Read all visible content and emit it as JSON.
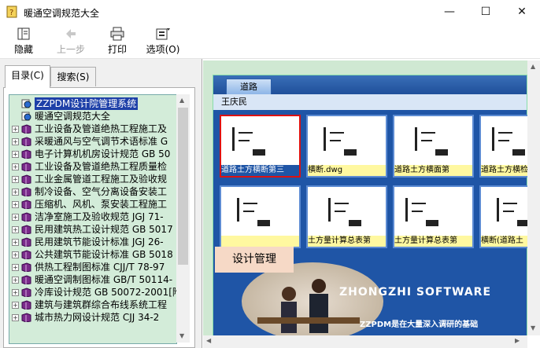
{
  "window": {
    "title": "暖通空调规范大全",
    "minimize": "—",
    "maximize": "☐",
    "close": "✕"
  },
  "toolbar": [
    {
      "label": "隐藏",
      "icon": "hide-icon",
      "enabled": true
    },
    {
      "label": "上一步",
      "icon": "back-arrow-icon",
      "enabled": false
    },
    {
      "label": "打印",
      "icon": "printer-icon",
      "enabled": true
    },
    {
      "label": "选项(O)",
      "icon": "options-icon",
      "enabled": true
    }
  ],
  "tabs": [
    {
      "label": "目录(C)",
      "active": true
    },
    {
      "label": "搜索(S)",
      "active": false
    }
  ],
  "tree": [
    {
      "label": "ZZPDM设计院管理系统",
      "kind": "globe",
      "expander": false,
      "selected": true
    },
    {
      "label": "暖通空调规范大全",
      "kind": "globe",
      "expander": false,
      "selected": false
    },
    {
      "label": "工业设备及管道绝热工程施工及",
      "kind": "book",
      "expander": true
    },
    {
      "label": "采暖通风与空气调节术语标准 G",
      "kind": "book",
      "expander": true
    },
    {
      "label": "电子计算机机房设计规范 GB 50",
      "kind": "book",
      "expander": true
    },
    {
      "label": "工业设备及管道绝热工程质量检",
      "kind": "book",
      "expander": true
    },
    {
      "label": "工业金属管道工程施工及验收规",
      "kind": "book",
      "expander": true
    },
    {
      "label": "制冷设备、空气分离设备安装工",
      "kind": "book",
      "expander": true
    },
    {
      "label": "压缩机、风机、泵安装工程施工",
      "kind": "book",
      "expander": true
    },
    {
      "label": "洁净室施工及验收规范 JGJ 71-",
      "kind": "book",
      "expander": true
    },
    {
      "label": "民用建筑热工设计规范 GB 5017",
      "kind": "book",
      "expander": true
    },
    {
      "label": "民用建筑节能设计标准 JGJ 26-",
      "kind": "book",
      "expander": true
    },
    {
      "label": "公共建筑节能设计标准 GB 5018",
      "kind": "book",
      "expander": true
    },
    {
      "label": "供热工程制图标准 CJJ/T 78-97",
      "kind": "book",
      "expander": true
    },
    {
      "label": "暖通空调制图标准 GB/T 50114-",
      "kind": "book",
      "expander": true
    },
    {
      "label": "冷库设计规范 GB 50072-2001[附",
      "kind": "book",
      "expander": true
    },
    {
      "label": "建筑与建筑群综合布线系统工程",
      "kind": "book",
      "expander": true
    },
    {
      "label": "城市热力网设计规范 CJJ 34-2",
      "kind": "book",
      "expander": true
    }
  ],
  "viewer": {
    "tab": "道路",
    "user": "王庆民",
    "thumbs": [
      {
        "label": "道路土方横断第三",
        "selected": true
      },
      {
        "label": "横断.dwg",
        "selected": false
      },
      {
        "label": "道路土方横面第",
        "selected": false
      },
      {
        "label": "道路土方横检",
        "selected": false
      },
      {
        "label": "",
        "selected": false
      },
      {
        "label": "土方量计算总表第",
        "selected": false
      },
      {
        "label": "土方量计算总表第",
        "selected": false
      },
      {
        "label": "横断(道路土",
        "selected": false
      }
    ],
    "overlay": "设计管理",
    "brand": "ZHONGZHI SOFTWARE",
    "slogan": "ZZPDM是在大量深入调研的基础"
  },
  "colors": {
    "tree_bg": "#d3ecd9",
    "selection": "#1e40a8",
    "viewer_blue": "#1f55a6",
    "pane_green": "#cfe8d2"
  }
}
